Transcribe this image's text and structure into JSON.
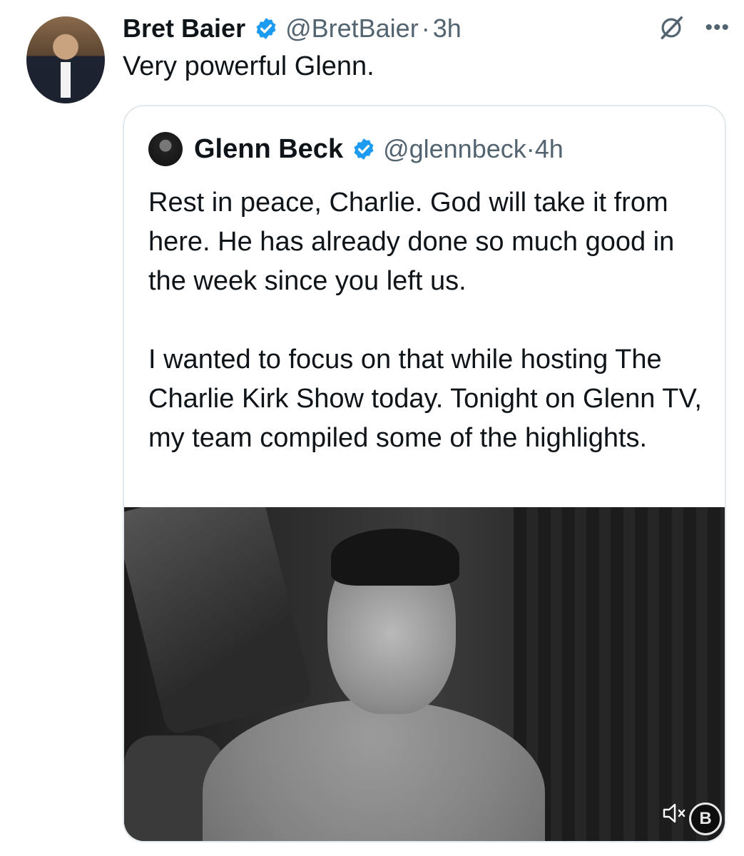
{
  "tweet": {
    "author_name": "Bret Baier",
    "author_handle": "@BretBaier",
    "separator": "·",
    "time": "3h",
    "text": "Very powerful Glenn."
  },
  "quote": {
    "author_name": "Glenn Beck",
    "author_handle": "@glennbeck",
    "separator": "·",
    "time": "4h",
    "paragraph1": "Rest in peace, Charlie. God will take it from here. He has already done so much good in the week since you left us.",
    "paragraph2": "I wanted to focus on that while hosting The Charlie Kirk Show today. Tonight on Glenn TV, my team compiled some of the highlights."
  },
  "media": {
    "brand_badge": "B"
  },
  "icons": {
    "verified": "verified-badge-icon",
    "grok": "grok-icon",
    "more": "more-options-icon",
    "mute": "muted-speaker-icon"
  },
  "colors": {
    "verified_blue": "#1d9bf0",
    "secondary_text": "#536471",
    "primary_text": "#0f1419"
  }
}
